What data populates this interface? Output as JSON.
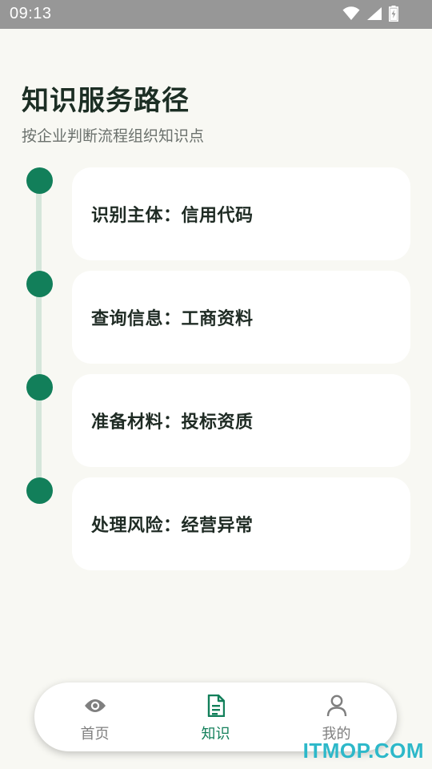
{
  "status_bar": {
    "time": "09:13",
    "icons": [
      "wifi-icon",
      "cellular-signal-icon",
      "battery-charging-icon"
    ]
  },
  "header": {
    "title": "知识服务路径",
    "subtitle": "按企业判断流程组织知识点"
  },
  "steps": [
    {
      "label": "识别主体：信用代码"
    },
    {
      "label": "查询信息：工商资料"
    },
    {
      "label": "准备材料：投标资质"
    },
    {
      "label": "处理风险：经营异常"
    }
  ],
  "bottom_nav": {
    "items": [
      {
        "label": "首页",
        "icon": "eye-icon",
        "active": false
      },
      {
        "label": "知识",
        "icon": "document-icon",
        "active": true
      },
      {
        "label": "我的",
        "icon": "user-icon",
        "active": false
      }
    ]
  },
  "watermark": "ITMOP.COM",
  "colors": {
    "accent": "#127f5a",
    "background": "#f8f8f3",
    "timeline_line": "#d5e6da",
    "status_bar": "#979797",
    "watermark": "#2db8c9"
  }
}
